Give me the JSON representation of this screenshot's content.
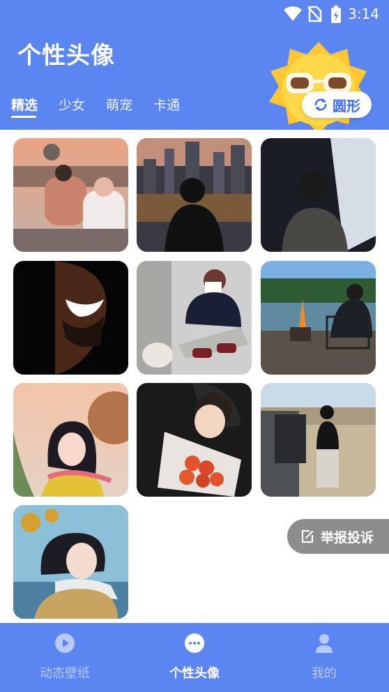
{
  "status_bar": {
    "time": "3:14",
    "icons": [
      "wifi-icon",
      "no-sim-icon",
      "battery-icon"
    ]
  },
  "header": {
    "title": "个性头像",
    "shape_button_label": "圆形"
  },
  "tabs": [
    {
      "label": "精选"
    },
    {
      "label": "少女"
    },
    {
      "label": "萌宠"
    },
    {
      "label": "卡通"
    }
  ],
  "report_button_label": "举报投诉",
  "bottom_nav": [
    {
      "label": "动态壁纸",
      "icon": "play-icon"
    },
    {
      "label": "个性头像",
      "icon": "chat-bubble-icon"
    },
    {
      "label": "我的",
      "icon": "user-icon"
    }
  ],
  "colors": {
    "brand_blue": "#5b86f2",
    "accent_text": "#3d6df0",
    "report_gray": "#8d8d8d"
  }
}
